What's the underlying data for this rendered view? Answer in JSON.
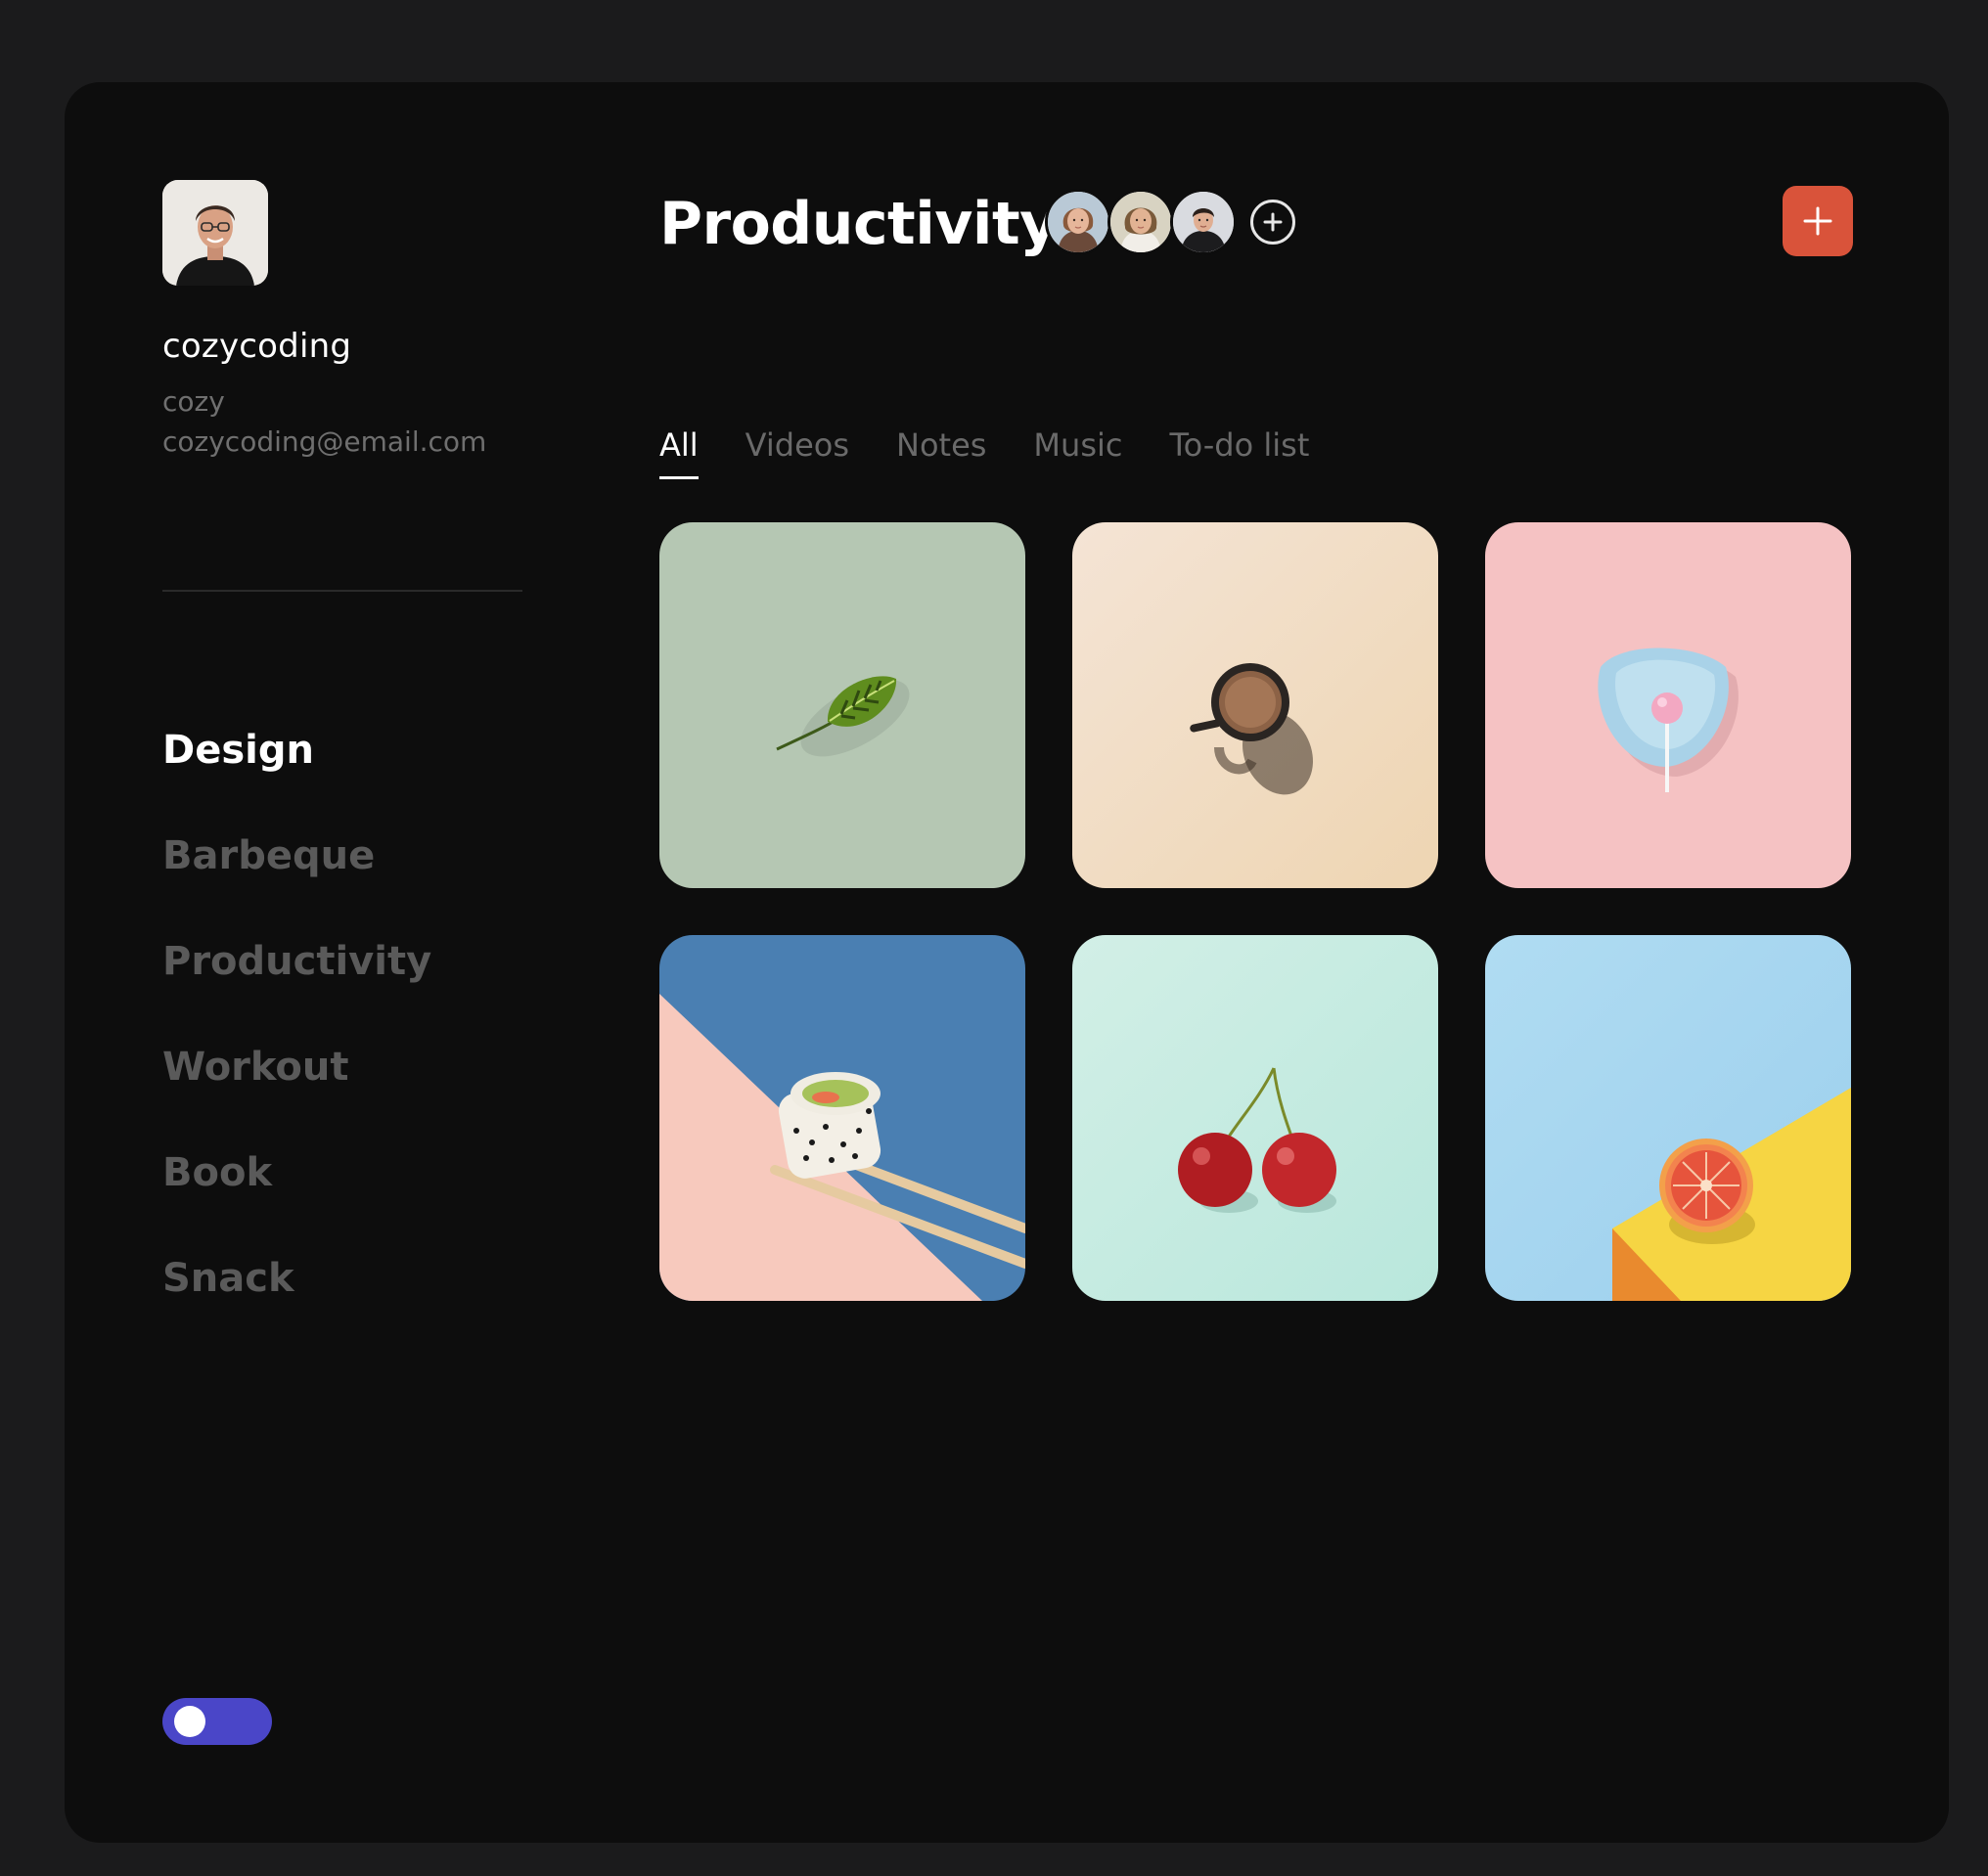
{
  "user": {
    "name": "cozycoding",
    "handle": "cozy",
    "email": "cozycoding@email.com"
  },
  "nav": {
    "items": [
      {
        "label": "Design",
        "active": true
      },
      {
        "label": "Barbeque",
        "active": false
      },
      {
        "label": "Productivity",
        "active": false
      },
      {
        "label": "Workout",
        "active": false
      },
      {
        "label": "Book",
        "active": false
      },
      {
        "label": "Snack",
        "active": false
      }
    ]
  },
  "header": {
    "title": "Productivity"
  },
  "tabs": [
    {
      "label": "All",
      "active": true
    },
    {
      "label": "Videos",
      "active": false
    },
    {
      "label": "Notes",
      "active": false
    },
    {
      "label": "Music",
      "active": false
    },
    {
      "label": "To-do list",
      "active": false
    }
  ],
  "cards": [
    {
      "subject": "leaf",
      "background": "#b5c7b3"
    },
    {
      "subject": "coffee-cup",
      "background": "#f1dfc8"
    },
    {
      "subject": "lollipop-plate",
      "background": "#f5c2c3"
    },
    {
      "subject": "sushi",
      "background": "#4a7fb2"
    },
    {
      "subject": "cherries",
      "background": "#c7ebe0"
    },
    {
      "subject": "grapefruit",
      "background": "#a8d6ef"
    }
  ],
  "colors": {
    "page_background": "#1b1b1c",
    "app_background": "#0d0d0d",
    "accent_add": "#d9533a",
    "toggle": "#4a46c8",
    "nav_inactive": "#5a5a5a",
    "tab_inactive": "#6a6a6a"
  },
  "icons": {
    "add_member": "plus-circle-icon",
    "add_button": "plus-icon"
  },
  "toggle": {
    "on": false
  }
}
